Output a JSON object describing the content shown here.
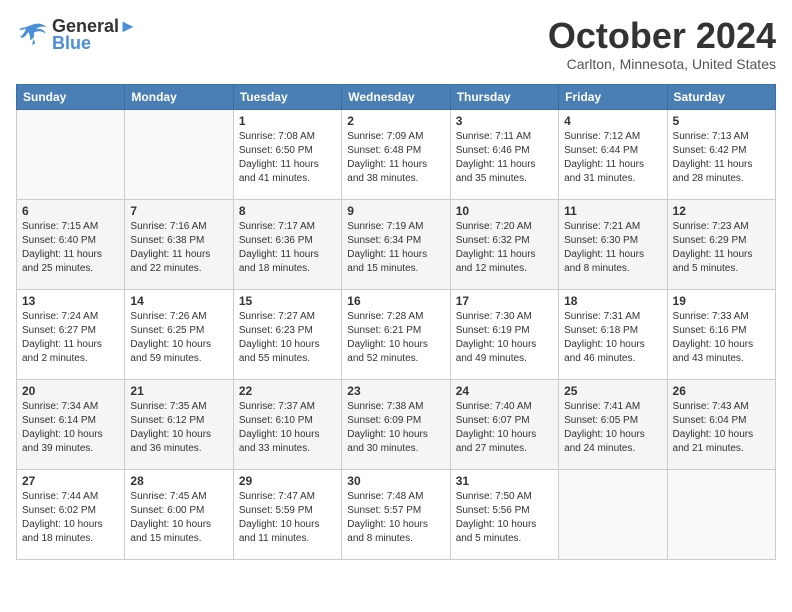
{
  "header": {
    "logo_line1": "General",
    "logo_line2": "Blue",
    "month": "October 2024",
    "location": "Carlton, Minnesota, United States"
  },
  "days_of_week": [
    "Sunday",
    "Monday",
    "Tuesday",
    "Wednesday",
    "Thursday",
    "Friday",
    "Saturday"
  ],
  "weeks": [
    [
      {
        "day": "",
        "sunrise": "",
        "sunset": "",
        "daylight": ""
      },
      {
        "day": "",
        "sunrise": "",
        "sunset": "",
        "daylight": ""
      },
      {
        "day": "1",
        "sunrise": "Sunrise: 7:08 AM",
        "sunset": "Sunset: 6:50 PM",
        "daylight": "Daylight: 11 hours and 41 minutes."
      },
      {
        "day": "2",
        "sunrise": "Sunrise: 7:09 AM",
        "sunset": "Sunset: 6:48 PM",
        "daylight": "Daylight: 11 hours and 38 minutes."
      },
      {
        "day": "3",
        "sunrise": "Sunrise: 7:11 AM",
        "sunset": "Sunset: 6:46 PM",
        "daylight": "Daylight: 11 hours and 35 minutes."
      },
      {
        "day": "4",
        "sunrise": "Sunrise: 7:12 AM",
        "sunset": "Sunset: 6:44 PM",
        "daylight": "Daylight: 11 hours and 31 minutes."
      },
      {
        "day": "5",
        "sunrise": "Sunrise: 7:13 AM",
        "sunset": "Sunset: 6:42 PM",
        "daylight": "Daylight: 11 hours and 28 minutes."
      }
    ],
    [
      {
        "day": "6",
        "sunrise": "Sunrise: 7:15 AM",
        "sunset": "Sunset: 6:40 PM",
        "daylight": "Daylight: 11 hours and 25 minutes."
      },
      {
        "day": "7",
        "sunrise": "Sunrise: 7:16 AM",
        "sunset": "Sunset: 6:38 PM",
        "daylight": "Daylight: 11 hours and 22 minutes."
      },
      {
        "day": "8",
        "sunrise": "Sunrise: 7:17 AM",
        "sunset": "Sunset: 6:36 PM",
        "daylight": "Daylight: 11 hours and 18 minutes."
      },
      {
        "day": "9",
        "sunrise": "Sunrise: 7:19 AM",
        "sunset": "Sunset: 6:34 PM",
        "daylight": "Daylight: 11 hours and 15 minutes."
      },
      {
        "day": "10",
        "sunrise": "Sunrise: 7:20 AM",
        "sunset": "Sunset: 6:32 PM",
        "daylight": "Daylight: 11 hours and 12 minutes."
      },
      {
        "day": "11",
        "sunrise": "Sunrise: 7:21 AM",
        "sunset": "Sunset: 6:30 PM",
        "daylight": "Daylight: 11 hours and 8 minutes."
      },
      {
        "day": "12",
        "sunrise": "Sunrise: 7:23 AM",
        "sunset": "Sunset: 6:29 PM",
        "daylight": "Daylight: 11 hours and 5 minutes."
      }
    ],
    [
      {
        "day": "13",
        "sunrise": "Sunrise: 7:24 AM",
        "sunset": "Sunset: 6:27 PM",
        "daylight": "Daylight: 11 hours and 2 minutes."
      },
      {
        "day": "14",
        "sunrise": "Sunrise: 7:26 AM",
        "sunset": "Sunset: 6:25 PM",
        "daylight": "Daylight: 10 hours and 59 minutes."
      },
      {
        "day": "15",
        "sunrise": "Sunrise: 7:27 AM",
        "sunset": "Sunset: 6:23 PM",
        "daylight": "Daylight: 10 hours and 55 minutes."
      },
      {
        "day": "16",
        "sunrise": "Sunrise: 7:28 AM",
        "sunset": "Sunset: 6:21 PM",
        "daylight": "Daylight: 10 hours and 52 minutes."
      },
      {
        "day": "17",
        "sunrise": "Sunrise: 7:30 AM",
        "sunset": "Sunset: 6:19 PM",
        "daylight": "Daylight: 10 hours and 49 minutes."
      },
      {
        "day": "18",
        "sunrise": "Sunrise: 7:31 AM",
        "sunset": "Sunset: 6:18 PM",
        "daylight": "Daylight: 10 hours and 46 minutes."
      },
      {
        "day": "19",
        "sunrise": "Sunrise: 7:33 AM",
        "sunset": "Sunset: 6:16 PM",
        "daylight": "Daylight: 10 hours and 43 minutes."
      }
    ],
    [
      {
        "day": "20",
        "sunrise": "Sunrise: 7:34 AM",
        "sunset": "Sunset: 6:14 PM",
        "daylight": "Daylight: 10 hours and 39 minutes."
      },
      {
        "day": "21",
        "sunrise": "Sunrise: 7:35 AM",
        "sunset": "Sunset: 6:12 PM",
        "daylight": "Daylight: 10 hours and 36 minutes."
      },
      {
        "day": "22",
        "sunrise": "Sunrise: 7:37 AM",
        "sunset": "Sunset: 6:10 PM",
        "daylight": "Daylight: 10 hours and 33 minutes."
      },
      {
        "day": "23",
        "sunrise": "Sunrise: 7:38 AM",
        "sunset": "Sunset: 6:09 PM",
        "daylight": "Daylight: 10 hours and 30 minutes."
      },
      {
        "day": "24",
        "sunrise": "Sunrise: 7:40 AM",
        "sunset": "Sunset: 6:07 PM",
        "daylight": "Daylight: 10 hours and 27 minutes."
      },
      {
        "day": "25",
        "sunrise": "Sunrise: 7:41 AM",
        "sunset": "Sunset: 6:05 PM",
        "daylight": "Daylight: 10 hours and 24 minutes."
      },
      {
        "day": "26",
        "sunrise": "Sunrise: 7:43 AM",
        "sunset": "Sunset: 6:04 PM",
        "daylight": "Daylight: 10 hours and 21 minutes."
      }
    ],
    [
      {
        "day": "27",
        "sunrise": "Sunrise: 7:44 AM",
        "sunset": "Sunset: 6:02 PM",
        "daylight": "Daylight: 10 hours and 18 minutes."
      },
      {
        "day": "28",
        "sunrise": "Sunrise: 7:45 AM",
        "sunset": "Sunset: 6:00 PM",
        "daylight": "Daylight: 10 hours and 15 minutes."
      },
      {
        "day": "29",
        "sunrise": "Sunrise: 7:47 AM",
        "sunset": "Sunset: 5:59 PM",
        "daylight": "Daylight: 10 hours and 11 minutes."
      },
      {
        "day": "30",
        "sunrise": "Sunrise: 7:48 AM",
        "sunset": "Sunset: 5:57 PM",
        "daylight": "Daylight: 10 hours and 8 minutes."
      },
      {
        "day": "31",
        "sunrise": "Sunrise: 7:50 AM",
        "sunset": "Sunset: 5:56 PM",
        "daylight": "Daylight: 10 hours and 5 minutes."
      },
      {
        "day": "",
        "sunrise": "",
        "sunset": "",
        "daylight": ""
      },
      {
        "day": "",
        "sunrise": "",
        "sunset": "",
        "daylight": ""
      }
    ]
  ]
}
